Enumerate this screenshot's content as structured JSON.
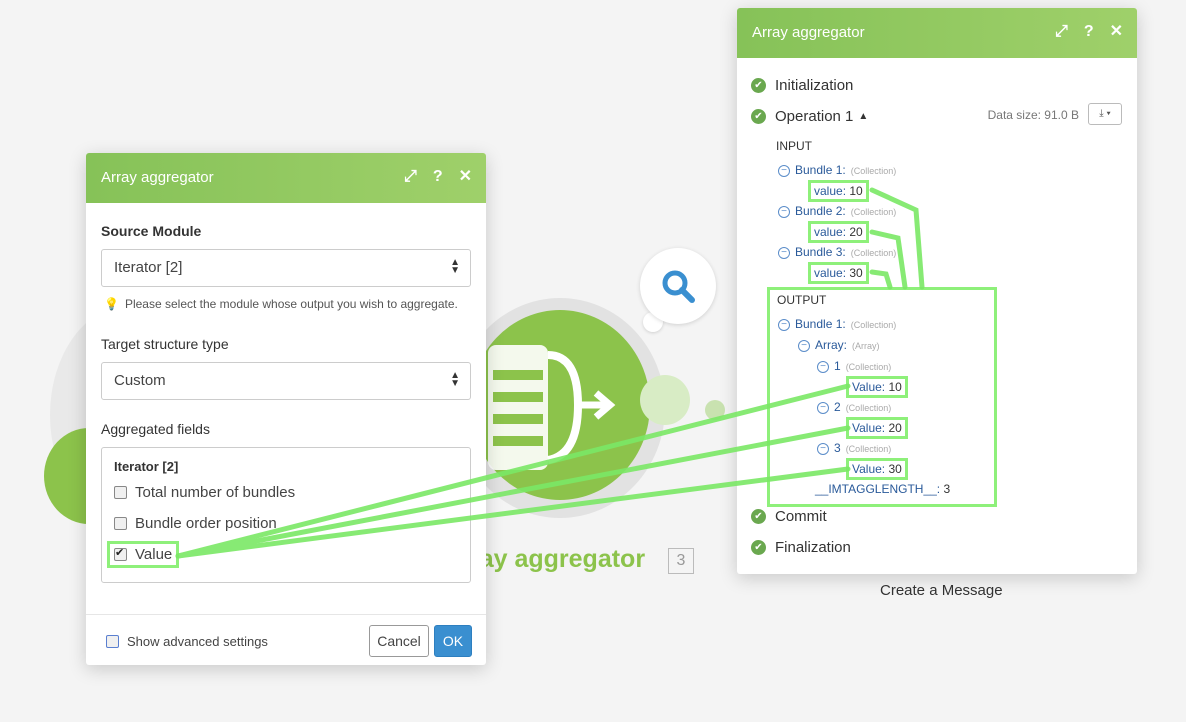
{
  "left_panel": {
    "title": "Array aggregator",
    "source_module_label": "Source Module",
    "source_module_value": "Iterator [2]",
    "hint": "Please select the module whose output you wish to aggregate.",
    "target_structure_label": "Target structure type",
    "target_structure_value": "Custom",
    "aggregated_fields_label": "Aggregated fields",
    "aggregated_group": "Iterator [2]",
    "fields": [
      {
        "label": "Total number of bundles",
        "checked": false
      },
      {
        "label": "Bundle order position",
        "checked": false
      },
      {
        "label": "Value",
        "checked": true
      }
    ],
    "show_advanced": "Show advanced settings",
    "cancel": "Cancel",
    "ok": "OK"
  },
  "right_panel": {
    "title": "Array aggregator",
    "initialization": "Initialization",
    "operation": "Operation 1",
    "data_size": "Data size: 91.0 B",
    "input_label": "INPUT",
    "input_bundles": [
      {
        "label": "Bundle 1:",
        "type": "(Collection)",
        "key": "value:",
        "value": "10"
      },
      {
        "label": "Bundle 2:",
        "type": "(Collection)",
        "key": "value:",
        "value": "20"
      },
      {
        "label": "Bundle 3:",
        "type": "(Collection)",
        "key": "value:",
        "value": "30"
      }
    ],
    "output_label": "OUTPUT",
    "output_bundle": "Bundle 1:",
    "output_bundle_type": "(Collection)",
    "array_label": "Array:",
    "array_type": "(Array)",
    "array_items": [
      {
        "index": "1",
        "type": "(Collection)",
        "key": "Value:",
        "value": "10"
      },
      {
        "index": "2",
        "type": "(Collection)",
        "key": "Value:",
        "value": "20"
      },
      {
        "index": "3",
        "type": "(Collection)",
        "key": "Value:",
        "value": "30"
      }
    ],
    "length_label": "__IMTAGGLENGTH__:",
    "length_value": "3",
    "commit": "Commit",
    "finalization": "Finalization"
  },
  "canvas": {
    "module_name": "ray aggregator",
    "module_badge": "3",
    "next_module": "Create a Message"
  },
  "colors": {
    "header_green": "#86c258",
    "highlight": "#8ef07a",
    "ok_blue": "#3a8fd0"
  }
}
